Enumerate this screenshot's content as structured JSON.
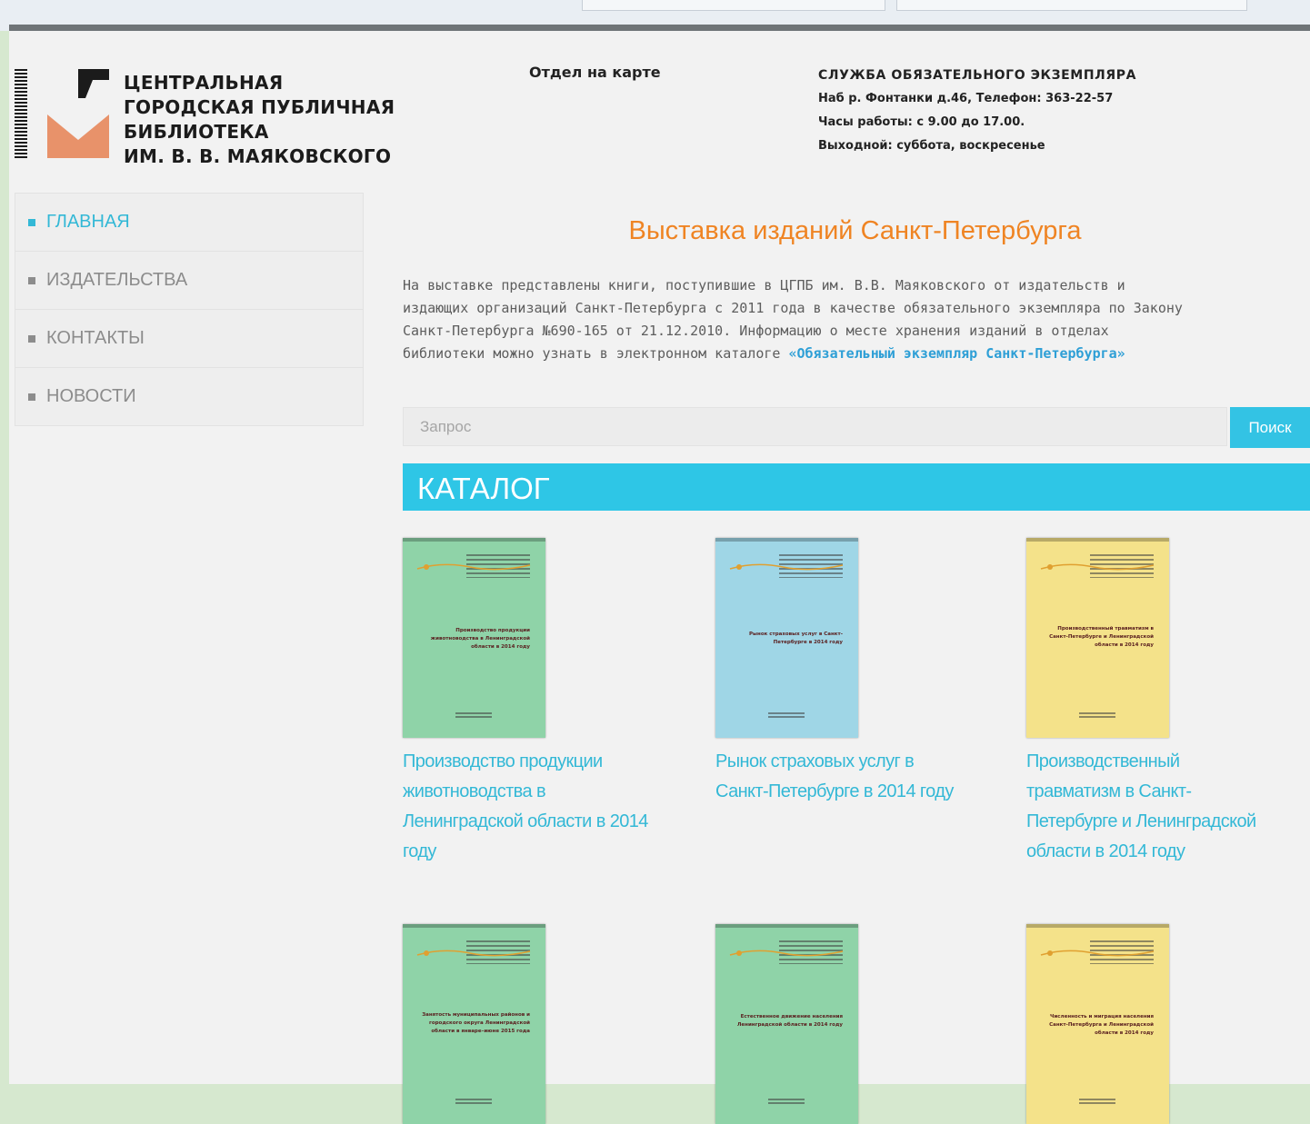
{
  "logo": {
    "line1": "ЦЕНТРАЛЬНАЯ",
    "line2": "ГОРОДСКАЯ ПУБЛИЧНАЯ",
    "line3": "БИБЛИОТЕКА",
    "line4": "ИМ. В. В. МАЯКОВСКОГО",
    "accent_color": "#e8926a"
  },
  "header": {
    "map_link": "Отдел на карте",
    "service_title": "СЛУЖБА ОБЯЗАТЕЛЬНОГО ЭКЗЕМПЛЯРА",
    "address": "Наб р. Фонтанки д.46, Телефон: 363-22-57",
    "hours": "Часы работы: с 9.00 до 17.00.",
    "days_off": "Выходной: суббота, воскресенье"
  },
  "sidebar": {
    "items": [
      {
        "label": "ГЛАВНАЯ",
        "active": true
      },
      {
        "label": "ИЗДАТЕЛЬСТВА",
        "active": false
      },
      {
        "label": "КОНТАКТЫ",
        "active": false
      },
      {
        "label": "НОВОСТИ",
        "active": false
      }
    ]
  },
  "main": {
    "title": "Выставка изданий Санкт-Петербурга",
    "intro_lines": [
      "На выставке представлены книги, поступившие в ЦГПБ им. В.В. Маяковского от издательств и",
      "издающих организаций Санкт-Петербурга с 2011 года в качестве обязательного экземпляра по Закону",
      "Санкт-Петербурга №690-165 от 21.12.2010. Информацию о месте хранения изданий в отделах",
      "библиотеки можно узнать в электронном каталоге "
    ],
    "intro_link": "«Обязательный экземпляр Санкт-Петербурга»",
    "search_placeholder": "Запрос",
    "search_button": "Поиск",
    "catalog_label": "КАТАЛОГ"
  },
  "catalog": [
    {
      "title": "Производство продукции животноводства в Ленинградской области в 2014 году",
      "cover_color": "#8fd3a8",
      "cover_text": "Производство продукции животноводства в Ленинградской области в 2014 году"
    },
    {
      "title": "Рынок страховых услуг в Санкт-Петербурге в 2014 году",
      "cover_color": "#9fd6e6",
      "cover_text": "Рынок страховых услуг в Санкт-Петербурге в 2014 году"
    },
    {
      "title": "Производственный травматизм в Санкт-Петербурге и Ленинградской области в 2014 году",
      "cover_color": "#f4e28a",
      "cover_text": "Производственный травматизм в Санкт-Петербурге и Ленинградской области в 2014 году"
    },
    {
      "title": "",
      "cover_color": "#8fd3a8",
      "cover_text": "Занятость муниципальных районов и городского округа Ленинградской области в январе–июне 2015 года"
    },
    {
      "title": "",
      "cover_color": "#8fd3a8",
      "cover_text": "Естественное движение населения Ленинградской области в 2014 году"
    },
    {
      "title": "",
      "cover_color": "#f4e28a",
      "cover_text": "Численность и миграция населения Санкт-Петербурга и Ленинградской области в 2014 году"
    }
  ]
}
